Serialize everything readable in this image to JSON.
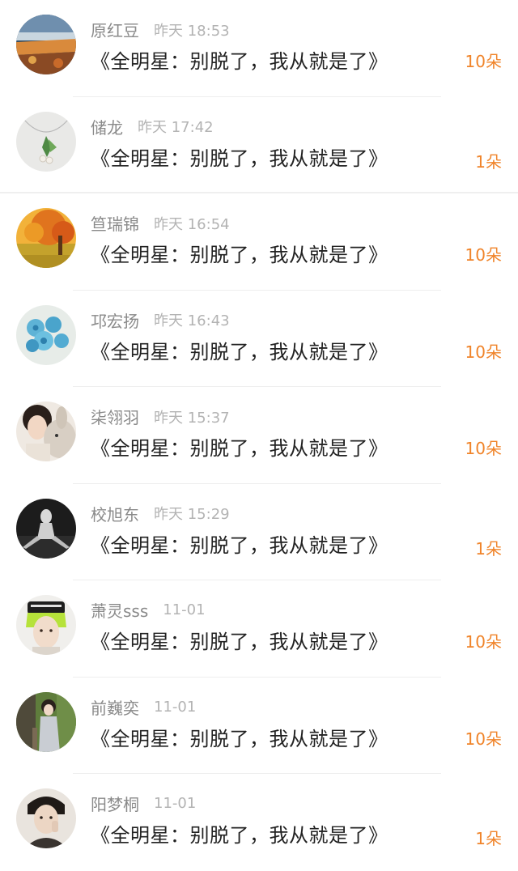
{
  "rows": [
    {
      "name": "原红豆",
      "time": "昨天 18:53",
      "gift": "《全明星：别脱了，我从就是了》",
      "count": "10朵",
      "avatar_icon": "landscape-avatar"
    },
    {
      "name": "储龙",
      "time": "昨天 17:42",
      "gift": "《全明星：别脱了，我从就是了》",
      "count": "1朵",
      "avatar_icon": "pearl-necklace-avatar"
    },
    {
      "name": "笪瑞锦",
      "time": "昨天 16:54",
      "gift": "《全明星：别脱了，我从就是了》",
      "count": "10朵",
      "avatar_icon": "autumn-tree-avatar"
    },
    {
      "name": "邛宏扬",
      "time": "昨天 16:43",
      "gift": "《全明星：别脱了，我从就是了》",
      "count": "10朵",
      "avatar_icon": "blue-roses-avatar"
    },
    {
      "name": "柒翎羽",
      "time": "昨天 15:37",
      "gift": "《全明星：别脱了，我从就是了》",
      "count": "10朵",
      "avatar_icon": "girl-with-plush-avatar"
    },
    {
      "name": "校旭东",
      "time": "昨天 15:29",
      "gift": "《全明星：别脱了，我从就是了》",
      "count": "1朵",
      "avatar_icon": "dancer-bw-avatar"
    },
    {
      "name": "萧灵sss",
      "time": "11-01",
      "gift": "《全明星：别脱了，我从就是了》",
      "count": "10朵",
      "avatar_icon": "green-hair-avatar"
    },
    {
      "name": "前巍奕",
      "time": "11-01",
      "gift": "《全明星：别脱了，我从就是了》",
      "count": "10朵",
      "avatar_icon": "girl-outdoor-avatar"
    },
    {
      "name": "阳梦桐",
      "time": "11-01",
      "gift": "《全明星：别脱了，我从就是了》",
      "count": "1朵",
      "avatar_icon": "man-portrait-avatar"
    }
  ],
  "colors": {
    "count": "#f0842a",
    "name": "#8a8a8a",
    "time": "#b3b3b3",
    "gift": "#222222"
  }
}
